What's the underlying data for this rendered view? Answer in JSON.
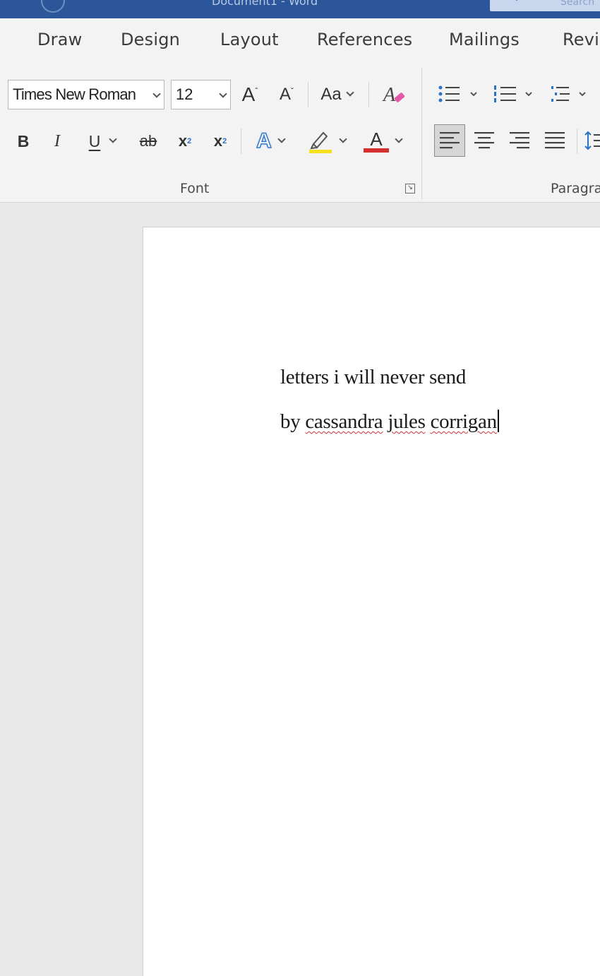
{
  "titlebar": {
    "document_title": "Document1 - Word",
    "search_label": "Search",
    "color": "#2b579a"
  },
  "tabs": [
    {
      "label": "Draw"
    },
    {
      "label": "Design"
    },
    {
      "label": "Layout"
    },
    {
      "label": "References"
    },
    {
      "label": "Mailings"
    },
    {
      "label": "Revi"
    }
  ],
  "ribbon": {
    "font_name": "Times New Roman",
    "font_size": "12",
    "groups": {
      "font": "Font",
      "paragraph": "Paragra"
    },
    "buttons": {
      "grow_font": "A",
      "shrink_font": "A",
      "change_case": "Aa",
      "bold": "B",
      "italic": "I",
      "underline": "U",
      "strikethrough": "ab",
      "subscript": "x",
      "superscript": "x",
      "text_effects": "A",
      "font_color": "A"
    },
    "colors": {
      "highlight": "#f2e11c",
      "font_color": "#d32f2f",
      "text_effects": "#3a78c9",
      "bullets": "#2b72c6"
    },
    "icons": [
      "clear-formatting-icon",
      "bullets-icon",
      "numbering-icon",
      "multilevel-list-icon",
      "highlighter-icon",
      "align-left-icon",
      "align-center-icon",
      "align-right-icon",
      "justify-icon",
      "line-spacing-icon",
      "dialog-launcher-icon"
    ]
  },
  "document": {
    "line1": "letters i will never send",
    "line2_prefix": "by ",
    "line2_words": [
      "cassandra",
      "jules",
      "corrigan"
    ]
  }
}
